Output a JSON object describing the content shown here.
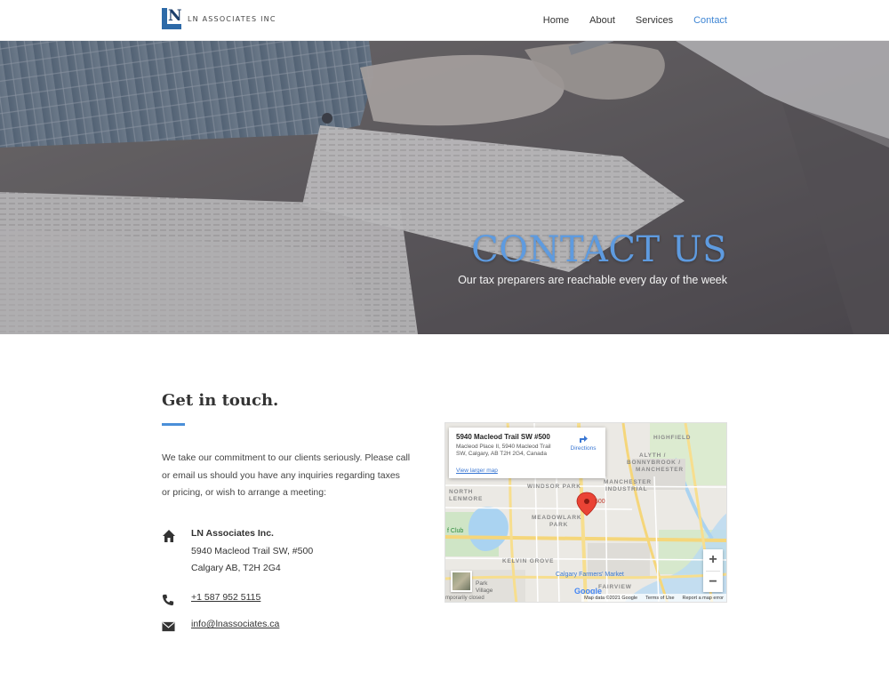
{
  "header": {
    "logo_mark": "N",
    "logo_text": "LN ASSOCIATES INC",
    "nav": [
      {
        "label": "Home",
        "active": false
      },
      {
        "label": "About",
        "active": false
      },
      {
        "label": "Services",
        "active": false
      },
      {
        "label": "Contact",
        "active": true
      }
    ]
  },
  "hero": {
    "title": "CONTACT US",
    "subtitle": "Our tax preparers are reachable every day of the week"
  },
  "contact": {
    "heading": "Get in touch.",
    "intro": "We take our commitment to our clients seriously. Please call or email us should you have any inquiries regarding taxes or pricing, or wish to arrange a meeting:",
    "company": "LN Associates Inc.",
    "address_line1": "5940 Macleod Trail SW, #500",
    "address_line2": "Calgary AB, T2H 2G4",
    "phone": "+1 587 952 5115",
    "email": "info@lnassociates.ca",
    "icons": [
      "home-icon",
      "phone-icon",
      "envelope-icon"
    ]
  },
  "map": {
    "card_title": "5940 Macleod Trail SW #500",
    "card_address": "Macleod Place II, 5940 Macleod Trail SW, Calgary, AB T2H 2G4, Canada",
    "directions": "Directions",
    "view_larger": "View larger map",
    "marker_label": "500",
    "labels": {
      "highfield": "HIGHFIELD",
      "alyth": "ALYTH /",
      "bonnybrook": "BONNYBROOK /",
      "manchester": "MANCHESTER",
      "north": "NORTH",
      "lenmore": "LENMORE",
      "windsor_park": "WINDSOR PARK",
      "manchester_industrial1": "MANCHESTER",
      "manchester_industrial2": "INDUSTRIAL",
      "meadowlark1": "MEADOWLARK",
      "meadowlark2": "PARK",
      "kelvin_grove": "KELVIN GROVE",
      "fairview": "FAIRVIEW",
      "club": "f Club",
      "farmers_market": "Calgary Farmers' Market",
      "park": "Park",
      "village": "Village",
      "temporarily_closed": "mporarily closed",
      "ogden": "Ogden Rd",
      "avenue": "58 Ave SE"
    },
    "zoom_in": "+",
    "zoom_out": "−",
    "footer": [
      "Map data ©2021 Google",
      "Terms of Use",
      "Report a map error"
    ],
    "google": "Google"
  },
  "colors": {
    "accent": "#3f86d4",
    "hero_title": "#5e9be0",
    "rule": "#4a8fd8"
  }
}
